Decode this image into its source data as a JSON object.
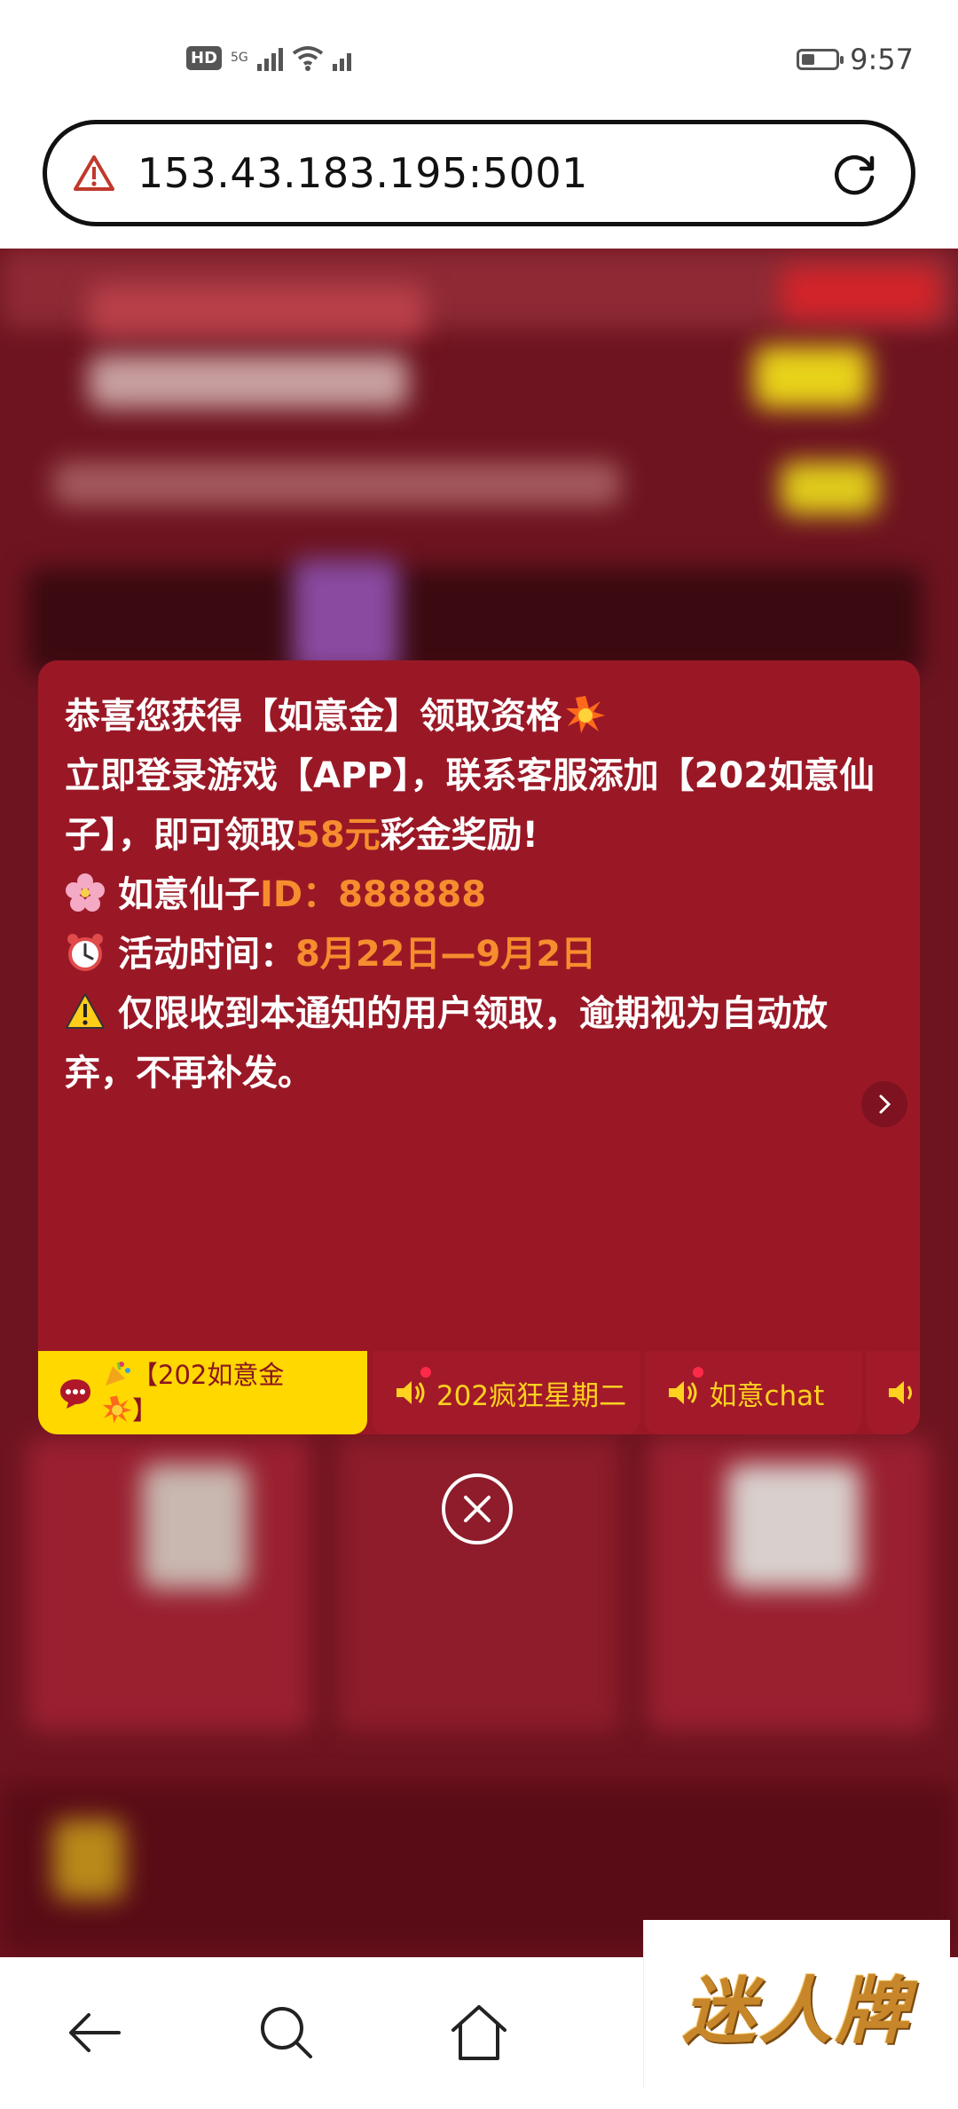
{
  "status_bar": {
    "hd_badge": "HD",
    "network": "5G",
    "time": "9:57"
  },
  "browser": {
    "url": "153.43.183.195:5001",
    "warning_icon": "warning-triangle-icon",
    "reload_icon": "reload-icon"
  },
  "popup": {
    "line1_text": "恭喜您获得【如意金】领取资格",
    "line2_a": "立即登录游戏【APP】，联系客服添加【202如意仙子】，即可领取",
    "line2_amount": "58元",
    "line2_b": "彩金奖励!",
    "line3_label": "如意仙子",
    "line3_id_label": "ID：",
    "line3_id": "888888",
    "line4_label": "活动时间：",
    "line4_dates": "8月22日—9月2日",
    "line5_text": "仅限收到本通知的用户领取，逾期视为自动放弃，不再补发。",
    "accent_color": "#f68d2e"
  },
  "tabs": [
    {
      "label": "【202如意金",
      "label2": "】",
      "active": true,
      "icon": "chat-bubble-icon"
    },
    {
      "label": "202疯狂星期二",
      "active": false,
      "icon": "speaker-icon"
    },
    {
      "label": "如意chat",
      "active": false,
      "icon": "speaker-icon"
    }
  ],
  "brand": {
    "watermark": "迷人牌"
  }
}
